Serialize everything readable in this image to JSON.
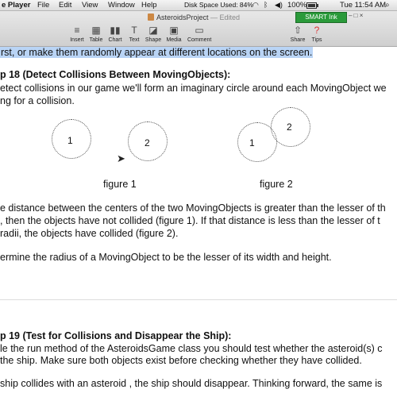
{
  "menubar": {
    "app": "e Player",
    "items": [
      "File",
      "Edit",
      "View",
      "Window",
      "Help"
    ],
    "disk_space": "Disk Space Used: 84%",
    "battery": "100%",
    "clock": "Tue 11:54 AM"
  },
  "toolbar": {
    "doc_title": "AsteroidsProject",
    "doc_status": "— Edited",
    "smart_ink": "SMART Ink",
    "buttons": {
      "insert": "Insert",
      "table": "Table",
      "chart": "Chart",
      "text": "Text",
      "shape": "Shape",
      "media": "Media",
      "comment": "Comment",
      "share": "Share",
      "tips": "Tips"
    }
  },
  "content": {
    "line_top": "rst, or make them randomly appear at different locations on the screen.",
    "step18_heading": "p 18 (Detect Collisions Between MovingObjects):",
    "step18_l1": "etect collisions in our game we'll form an imaginary circle around each MovingObject we",
    "step18_l2": "ng for a collision.",
    "fig1_c1": "1",
    "fig1_c2": "2",
    "fig2_c1": "1",
    "fig2_c2": "2",
    "figure1": "figure 1",
    "figure2": "figure 2",
    "p1_l1": "e distance between the centers of the two MovingObjects is greater than the lesser of th",
    "p1_l2": ", then the objects have not collided (figure 1).  If that distance is less than the lesser of t",
    "p1_l3": "radii, the objects have collided (figure 2).",
    "p2": "ermine the radius of a MovingObject to be the lesser of its width and height.",
    "step19_heading": "p 19 (Test for Collisions and Disappear the Ship):",
    "step19_l1": "le the run method of the AsteroidsGame class you should test whether the asteroid(s) c",
    "step19_l2": "the ship.  Make sure both objects exist before checking whether they have collided.",
    "step19_l3": "ship collides with an asteroid , the ship should disappear.  Thinking forward, the same is"
  }
}
